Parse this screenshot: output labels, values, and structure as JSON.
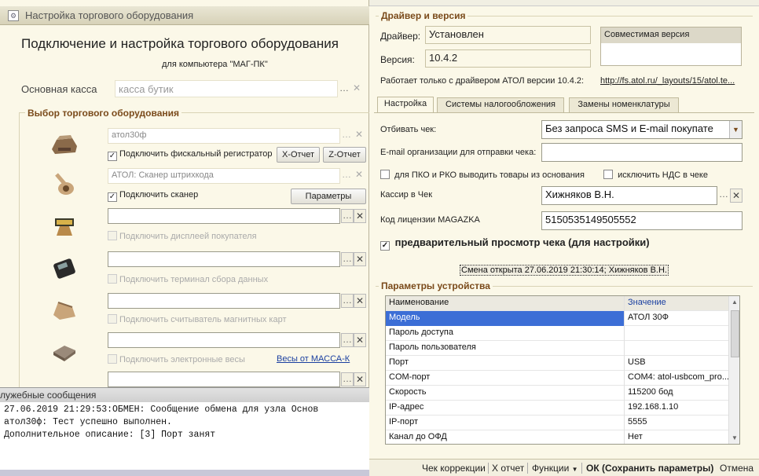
{
  "left_window": {
    "title": "Настройка торгового оборудования",
    "heading": "Подключение и настройка торгового оборудования",
    "computer_line": "для компьютера \"МАГ-ПК\"",
    "cash_label": "Основная касса",
    "cash_value": "касса бутик",
    "group_title": "Выбор торгового оборудования",
    "devices": {
      "fiscal_field": "атол30ф",
      "fiscal_check": "Подключить фискальный регистратор",
      "x_report": "X-Отчет",
      "z_report": "Z-Отчет",
      "scanner_field": "АТОЛ: Сканер штрихкода",
      "scanner_check": "Подключить сканер",
      "params_button": "Параметры",
      "display_check": "Подключить дисплеей покупателя",
      "terminal_check": "Подключить терминал сбора данных",
      "magcard_check": "Подключить считыватель магнитных карт",
      "scales_check": "Подключить электронные весы",
      "scales_link": "Весы от МАССА-К"
    },
    "messages": {
      "title": "лужебные сообщения",
      "lines": [
        "27.06.2019 21:29:53:ОБМЕН: Сообщение обмена для узла Основ",
        "атол30ф: Тест успешно выполнен.",
        "Дополнительное описание: [3] Порт занят"
      ]
    }
  },
  "right_window": {
    "driver_group_title": "Драйвер и версия",
    "driver_label": "Драйвер:",
    "driver_value": "Установлен",
    "version_label": "Версия:",
    "version_value": "10.4.2",
    "compat_header": "Совместимая версия",
    "works_only": "Работает только с драйвером АТОЛ версии 10.4.2:",
    "atol_link": "http://fs.atol.ru/_layouts/15/atol.te...",
    "tabs": [
      "Настройка",
      "Системы налогообложения",
      "Замены номенклатуры"
    ],
    "receipt_label": "Отбивать чек:",
    "receipt_value": "Без запроса SMS и E-mail покупате",
    "email_label": "E-mail организации для отправки чека:",
    "email_value": "",
    "pko_check": "для ПКО и РКО выводить товары из основания",
    "nds_check": "исключить НДС в чеке",
    "cashier_label": "Кассир в Чек",
    "cashier_value": "Хижняков В.Н.",
    "license_label": "Код лицензии MAGAZKA",
    "license_value": "5150535149505552",
    "preview_check": "предварительный просмотр чека (для настройки)",
    "shift_status": "Смена открыта 27.06.2019 21:30:14; Хижняков В.Н.",
    "params_group_title": "Параметры устройства",
    "table": {
      "headers": [
        "Наименование",
        "Значение"
      ],
      "rows": [
        [
          "Модель",
          "АТОЛ 30Ф"
        ],
        [
          "Пароль доступа",
          ""
        ],
        [
          "Пароль пользователя",
          ""
        ],
        [
          "Порт",
          "USB"
        ],
        [
          "COM-порт",
          "COM4: atol-usbcom_pro..."
        ],
        [
          "Скорость",
          "115200 бод"
        ],
        [
          "IP-адрес",
          "192.168.1.10"
        ],
        [
          "IP-порт",
          "5555"
        ],
        [
          "Канал до ОФД",
          "Нет"
        ]
      ]
    },
    "bottom": {
      "correction": "Чек коррекции",
      "x_report": "Х отчет",
      "functions": "Функции",
      "ok": "ОК (Сохранить параметры)",
      "cancel": "Отмена"
    }
  }
}
